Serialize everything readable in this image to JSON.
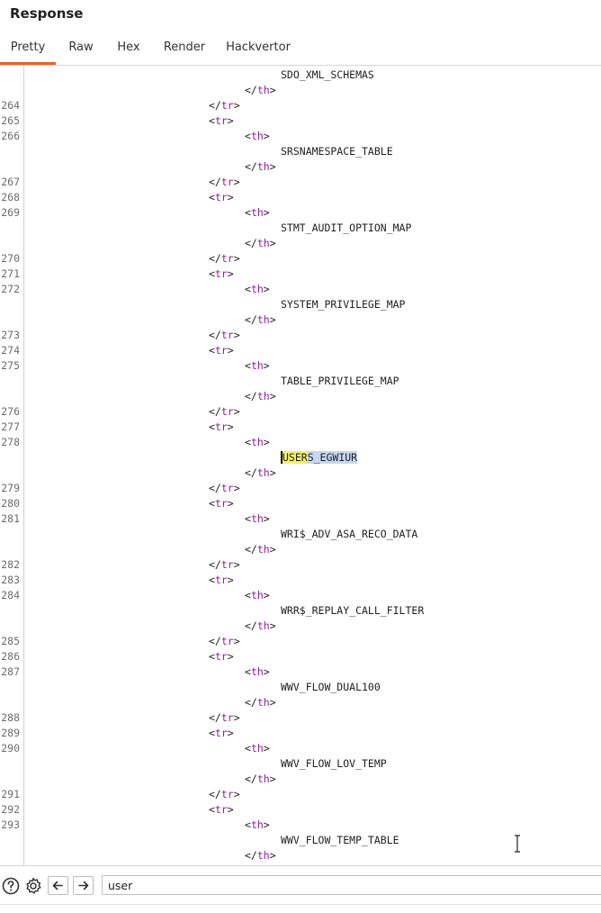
{
  "panel": {
    "title": "Response"
  },
  "tabs": [
    {
      "label": "Pretty",
      "active": true
    },
    {
      "label": "Raw",
      "active": false
    },
    {
      "label": "Hex",
      "active": false
    },
    {
      "label": "Render",
      "active": false
    },
    {
      "label": "Hackvertor",
      "active": false
    }
  ],
  "code": {
    "lines": [
      {
        "num": "",
        "kind": "text",
        "text": "SDO_XML_SCHEMAS"
      },
      {
        "num": "",
        "kind": "close",
        "tag": "th"
      },
      {
        "num": "264",
        "kind": "close",
        "tag": "tr"
      },
      {
        "num": "265",
        "kind": "open",
        "tag": "tr"
      },
      {
        "num": "266",
        "kind": "open",
        "tag": "th"
      },
      {
        "num": "",
        "kind": "text",
        "text": "SRSNAMESPACE_TABLE"
      },
      {
        "num": "",
        "kind": "close",
        "tag": "th"
      },
      {
        "num": "267",
        "kind": "close",
        "tag": "tr"
      },
      {
        "num": "268",
        "kind": "open",
        "tag": "tr"
      },
      {
        "num": "269",
        "kind": "open",
        "tag": "th"
      },
      {
        "num": "",
        "kind": "text",
        "text": "STMT_AUDIT_OPTION_MAP"
      },
      {
        "num": "",
        "kind": "close",
        "tag": "th"
      },
      {
        "num": "270",
        "kind": "close",
        "tag": "tr"
      },
      {
        "num": "271",
        "kind": "open",
        "tag": "tr"
      },
      {
        "num": "272",
        "kind": "open",
        "tag": "th"
      },
      {
        "num": "",
        "kind": "text",
        "text": "SYSTEM_PRIVILEGE_MAP"
      },
      {
        "num": "",
        "kind": "close",
        "tag": "th"
      },
      {
        "num": "273",
        "kind": "close",
        "tag": "tr"
      },
      {
        "num": "274",
        "kind": "open",
        "tag": "tr"
      },
      {
        "num": "275",
        "kind": "open",
        "tag": "th"
      },
      {
        "num": "",
        "kind": "text",
        "text": "TABLE_PRIVILEGE_MAP"
      },
      {
        "num": "",
        "kind": "close",
        "tag": "th"
      },
      {
        "num": "276",
        "kind": "close",
        "tag": "tr"
      },
      {
        "num": "277",
        "kind": "open",
        "tag": "tr"
      },
      {
        "num": "278",
        "kind": "open",
        "tag": "th"
      },
      {
        "num": "",
        "kind": "match",
        "match": "USER",
        "rest": "S_EGWIUR"
      },
      {
        "num": "",
        "kind": "close",
        "tag": "th"
      },
      {
        "num": "279",
        "kind": "close",
        "tag": "tr"
      },
      {
        "num": "280",
        "kind": "open",
        "tag": "tr"
      },
      {
        "num": "281",
        "kind": "open",
        "tag": "th"
      },
      {
        "num": "",
        "kind": "text",
        "text": "WRI$_ADV_ASA_RECO_DATA"
      },
      {
        "num": "",
        "kind": "close",
        "tag": "th"
      },
      {
        "num": "282",
        "kind": "close",
        "tag": "tr"
      },
      {
        "num": "283",
        "kind": "open",
        "tag": "tr"
      },
      {
        "num": "284",
        "kind": "open",
        "tag": "th"
      },
      {
        "num": "",
        "kind": "text",
        "text": "WRR$_REPLAY_CALL_FILTER"
      },
      {
        "num": "",
        "kind": "close",
        "tag": "th"
      },
      {
        "num": "285",
        "kind": "close",
        "tag": "tr"
      },
      {
        "num": "286",
        "kind": "open",
        "tag": "tr"
      },
      {
        "num": "287",
        "kind": "open",
        "tag": "th"
      },
      {
        "num": "",
        "kind": "text",
        "text": "WWV_FLOW_DUAL100"
      },
      {
        "num": "",
        "kind": "close",
        "tag": "th"
      },
      {
        "num": "288",
        "kind": "close",
        "tag": "tr"
      },
      {
        "num": "289",
        "kind": "open",
        "tag": "tr"
      },
      {
        "num": "290",
        "kind": "open",
        "tag": "th"
      },
      {
        "num": "",
        "kind": "text",
        "text": "WWV_FLOW_LOV_TEMP"
      },
      {
        "num": "",
        "kind": "close",
        "tag": "th"
      },
      {
        "num": "291",
        "kind": "close",
        "tag": "tr"
      },
      {
        "num": "292",
        "kind": "open",
        "tag": "tr"
      },
      {
        "num": "293",
        "kind": "open",
        "tag": "th"
      },
      {
        "num": "",
        "kind": "text",
        "text": "WWV_FLOW_TEMP_TABLE"
      },
      {
        "num": "",
        "kind": "close",
        "tag": "th"
      }
    ]
  },
  "footer": {
    "help_icon": "question-circle-icon",
    "settings_icon": "gear-icon",
    "prev_icon": "arrow-left-icon",
    "next_icon": "arrow-right-icon",
    "search_value": "user"
  },
  "colors": {
    "accent": "#e8622a",
    "tag": "#8b1f9b",
    "match_highlight": "#f4f06a",
    "selection": "#c6d7ef"
  }
}
